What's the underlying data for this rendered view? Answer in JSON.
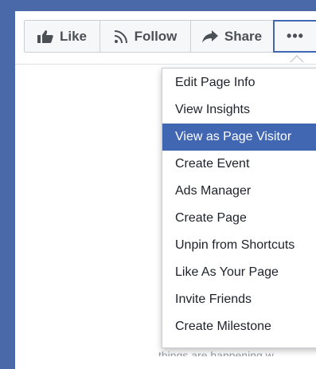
{
  "action_bar": {
    "like_label": "Like",
    "follow_label": "Follow",
    "share_label": "Share",
    "more_label": "•••",
    "icons": {
      "like": "thumbs-up-icon",
      "follow": "rss-feed-icon",
      "share": "share-arrow-icon"
    }
  },
  "dropdown_menu": {
    "items": [
      {
        "label": "Edit Page Info",
        "highlighted": false
      },
      {
        "label": "View Insights",
        "highlighted": false
      },
      {
        "label": "View as Page Visitor",
        "highlighted": true
      },
      {
        "label": "Create Event",
        "highlighted": false
      },
      {
        "label": "Ads Manager",
        "highlighted": false
      },
      {
        "label": "Create Page",
        "highlighted": false
      },
      {
        "label": "Unpin from Shortcuts",
        "highlighted": false
      },
      {
        "label": "Like As Your Page",
        "highlighted": false
      },
      {
        "label": "Invite Friends",
        "highlighted": false
      },
      {
        "label": "Create Milestone",
        "highlighted": false
      }
    ]
  },
  "background_text": "things are happening w",
  "colors": {
    "page_background": "#4a69a8",
    "highlight": "#4267b2",
    "button_text": "#4b4f56",
    "menu_text": "#1d2129"
  }
}
